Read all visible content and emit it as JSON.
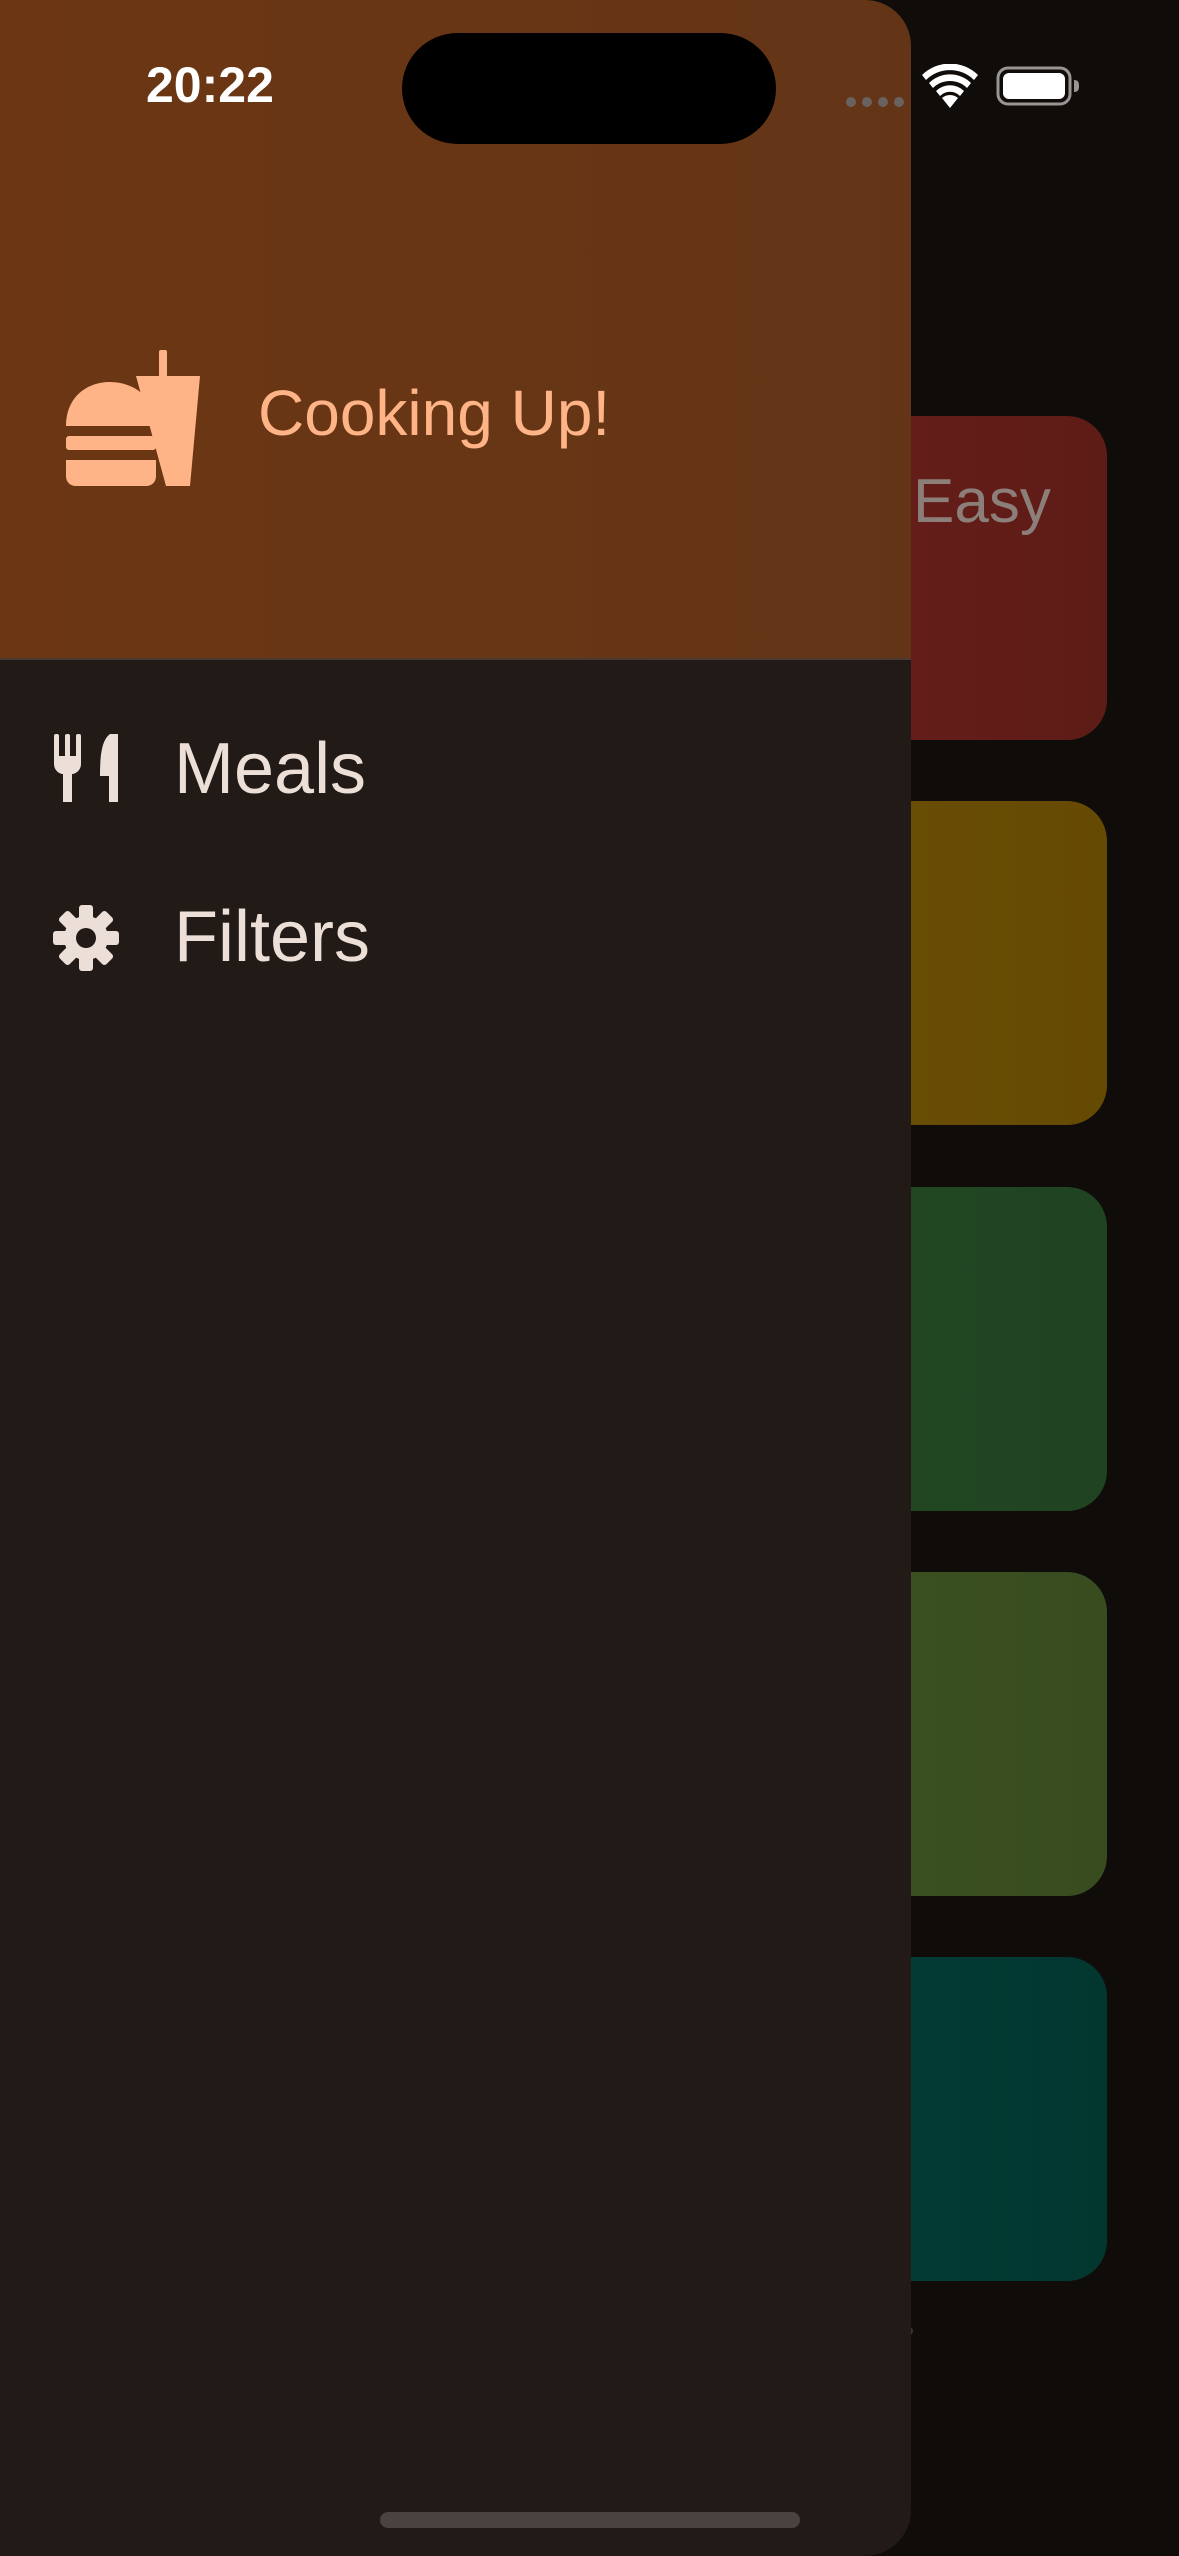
{
  "status_bar": {
    "time": "20:22"
  },
  "drawer": {
    "header": {
      "title": "Cooking Up!",
      "icon": "burger-drink-icon"
    },
    "items": [
      {
        "label": "Meals",
        "icon": "fork-knife-icon"
      },
      {
        "label": "Filters",
        "icon": "gear-icon"
      }
    ]
  },
  "background": {
    "first_card_text": "Easy",
    "tab_label_fragment": "tes",
    "card_colors": [
      "#621c18",
      "#674d05",
      "#224622",
      "#3b5021",
      "#023b34"
    ]
  },
  "colors": {
    "header_bg": "#6c3614",
    "drawer_bg": "#211a16",
    "accent": "#ffb487",
    "menu_text": "#ecdfd7"
  }
}
